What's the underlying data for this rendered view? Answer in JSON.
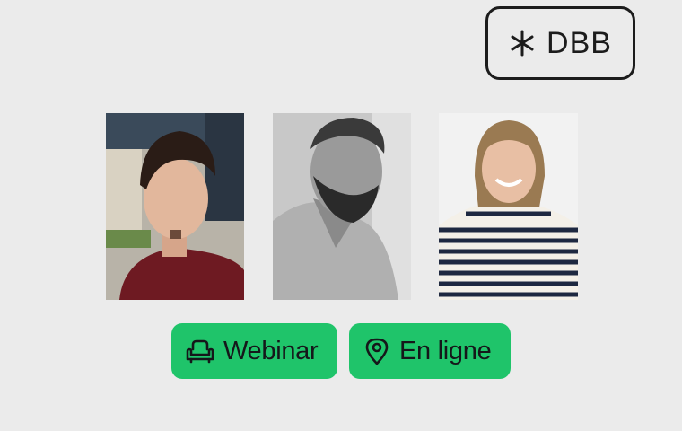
{
  "brand": {
    "name": "DBB",
    "icon": "asterisk-icon"
  },
  "speakers": [
    {
      "photo": "portrait-man-maroon-sweater"
    },
    {
      "photo": "portrait-bearded-man-bw"
    },
    {
      "photo": "portrait-woman-striped-shirt"
    }
  ],
  "tags": [
    {
      "label": "Webinar",
      "icon": "armchair-icon"
    },
    {
      "label": "En ligne",
      "icon": "map-pin-icon"
    }
  ],
  "colors": {
    "background": "#ebebeb",
    "tag": "#1fc46a",
    "ink": "#1c1c1c"
  }
}
